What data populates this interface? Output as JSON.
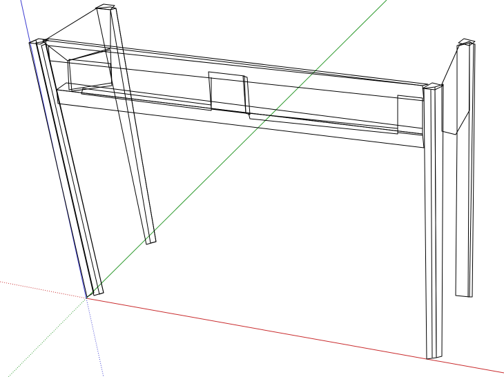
{
  "scene": {
    "background_color": "#ffffff",
    "face_light_color": "#ffffff",
    "face_mid_color": "#e4e4e4",
    "face_shade_color": "#bdbdbd",
    "face_dark_color": "#8f8f8f",
    "edge_color": "#000000",
    "axes": {
      "red_axis_color": "#c8282a",
      "green_axis_color": "#2e9a2e",
      "blue_axis_color": "#3a3ad0"
    }
  }
}
